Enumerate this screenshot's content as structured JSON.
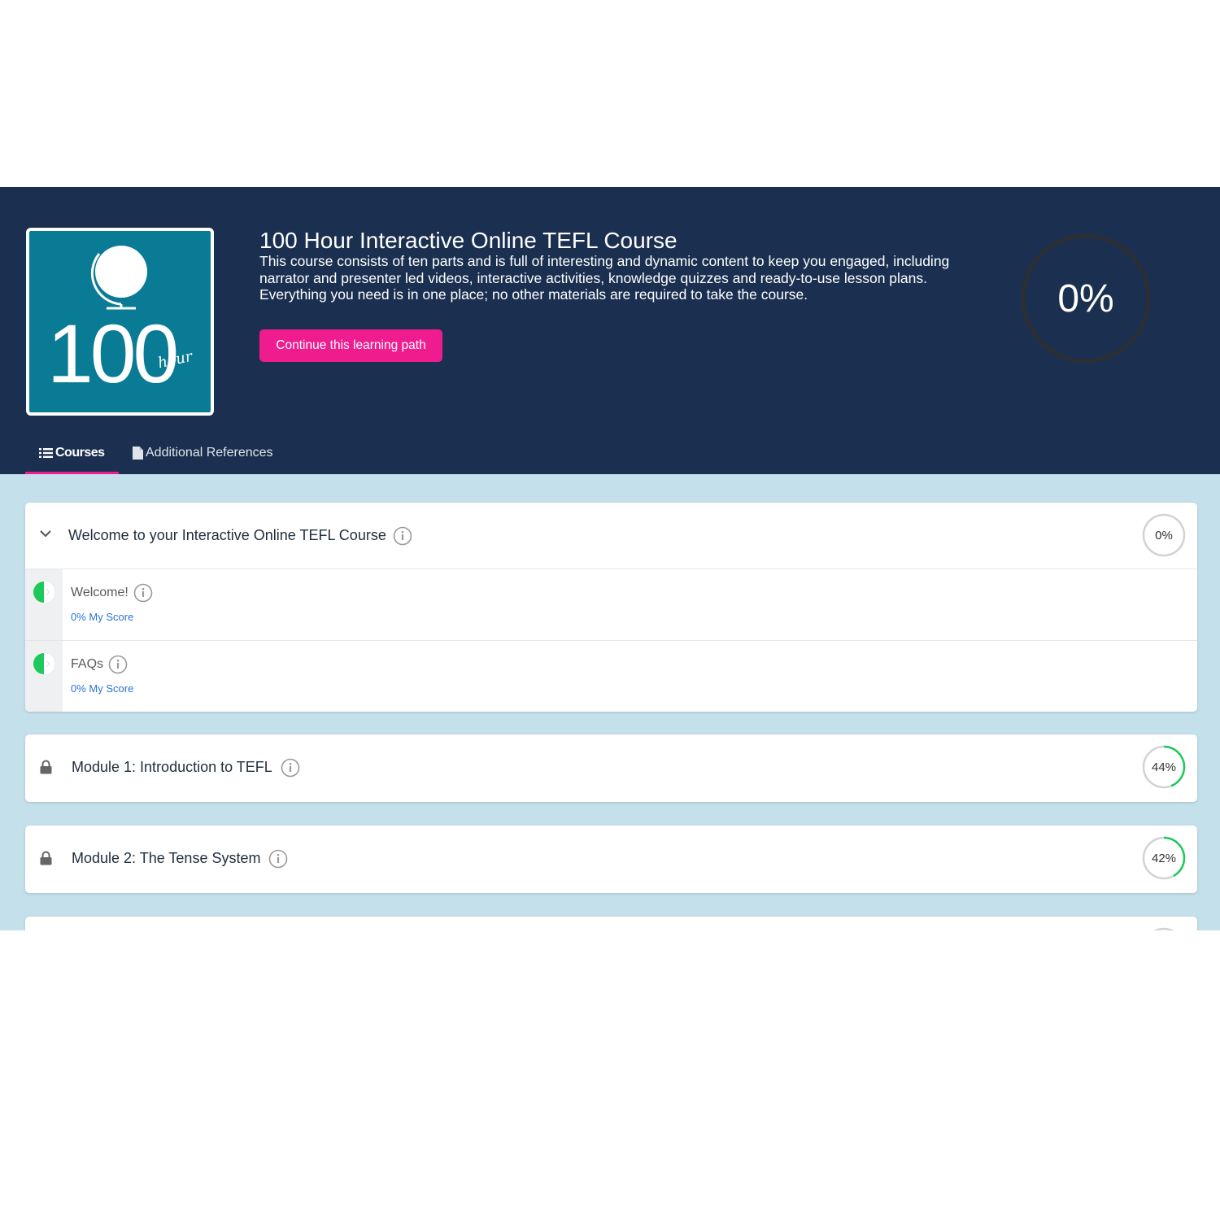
{
  "course": {
    "title": "100 Hour Interactive Online TEFL Course",
    "description": "This course consists of ten parts and is full of interesting and dynamic content to keep you engaged, including narrator and presenter led videos, interactive activities, knowledge quizzes and ready-to-use lesson plans. Everything you need is in one place; no other materials are required to take the course.",
    "continue_label": "Continue this learning path",
    "progress_label": "0%",
    "progress": 0,
    "logo": {
      "number": "100",
      "script": "hour"
    }
  },
  "tabs": [
    {
      "label": "Courses",
      "icon": "list-icon",
      "active": true
    },
    {
      "label": "Additional References",
      "icon": "document-icon",
      "active": false
    }
  ],
  "sections": [
    {
      "title": "Welcome to your Interactive Online TEFL Course",
      "progress_label": "0%",
      "progress": 0,
      "expanded": true,
      "lessons": [
        {
          "name": "Welcome!",
          "score": "0% My Score"
        },
        {
          "name": "FAQs",
          "score": "0% My Score"
        }
      ]
    },
    {
      "title": "Module 1: Introduction to TEFL",
      "progress_label": "44%",
      "progress": 0.44,
      "locked": true
    },
    {
      "title": "Module 2: The Tense System",
      "progress_label": "42%",
      "progress": 0.42,
      "locked": true
    }
  ],
  "colors": {
    "header_bg": "#1b3050",
    "accent_pink": "#ee1c8f",
    "logo_teal": "#0a7b94",
    "content_bg": "#c3e0eb",
    "progress_green": "#1ec95b",
    "link_blue": "#2a73d6"
  }
}
